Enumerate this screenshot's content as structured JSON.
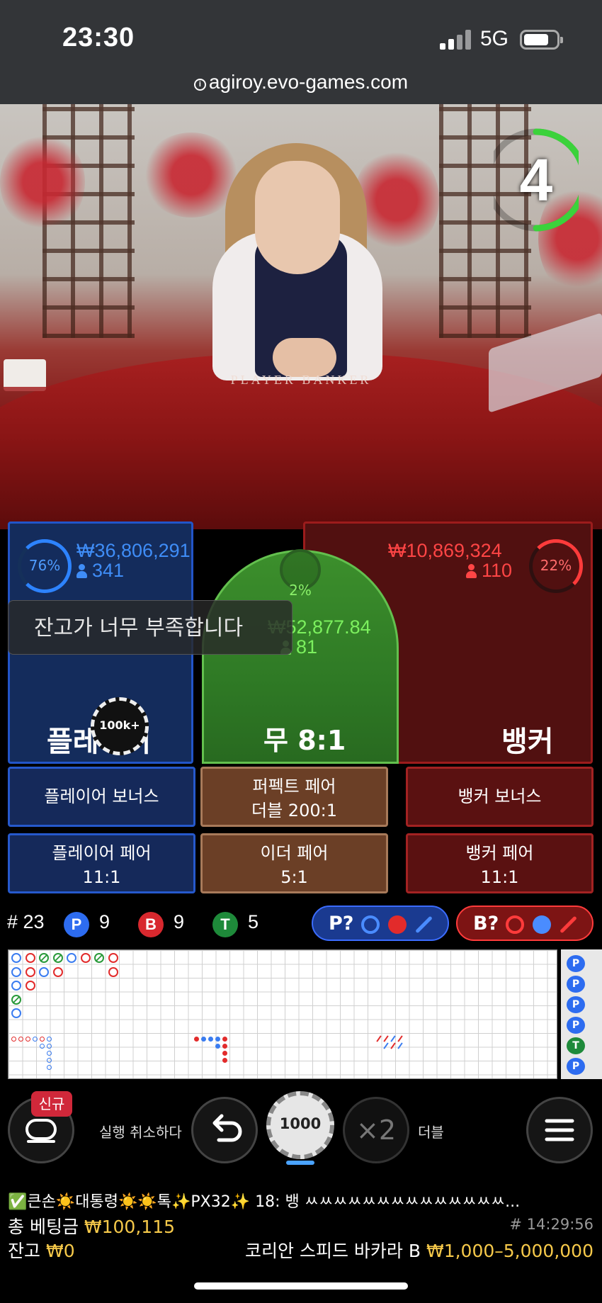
{
  "status_bar": {
    "time": "23:30",
    "network": "5G"
  },
  "browser": {
    "url": "agiroy.evo-games.com"
  },
  "video": {
    "countdown": "4",
    "felt_text": "PLAYER      BANKER"
  },
  "bets": {
    "player": {
      "label": "플레이어",
      "amount": "₩36,806,291",
      "count": "341",
      "percent": "76%"
    },
    "tie": {
      "label": "무 8:1",
      "amount": "₩52,877.84",
      "count": "81",
      "percent": "2%"
    },
    "banker": {
      "label": "뱅커",
      "amount": "₩10,869,324",
      "count": "110",
      "percent": "22%"
    },
    "toast": "잔고가 너무 부족합니다",
    "placed_chip": "100k+"
  },
  "side_bets": {
    "player_bonus": "플레이어 보너스",
    "perfect_pair": {
      "line1": "퍼펙트 페어",
      "line2": "더블 200:1"
    },
    "banker_bonus": "뱅커 보너스",
    "player_pair": {
      "line1": "플레이어 페어",
      "line2": "11:1"
    },
    "either_pair": {
      "line1": "이더 페어",
      "line2": "5:1"
    },
    "banker_pair": {
      "line1": "뱅커 페어",
      "line2": "11:1"
    }
  },
  "stats": {
    "round": "# 23",
    "player": {
      "badge": "P",
      "count": "9"
    },
    "banker": {
      "badge": "B",
      "count": "9"
    },
    "tie": {
      "badge": "T",
      "count": "5"
    },
    "predict_player": "P?",
    "predict_banker": "B?"
  },
  "roadmap_side": [
    "P",
    "P",
    "P",
    "P",
    "T",
    "P"
  ],
  "controls": {
    "new_badge": "신규",
    "undo_label": "실행 취소하다",
    "chip_value": "1000",
    "double_symbol": "×2",
    "double_label": "더블"
  },
  "footer": {
    "chat": "✅큰손☀️대통령☀️☀️톡✨PX32✨ 18: 뱅 ㅆㅆㅆㅆㅆㅆㅆㅆㅆㅆㅆㅆㅆㅆ...",
    "total_bet_label": "총 베팅금",
    "total_bet_value": "₩100,115",
    "round_id": "# 14:29:56",
    "balance_label": "잔고",
    "balance_value": "₩0",
    "table_name": "코리안 스피드 바카라 B",
    "limits": "₩1,000–5,000,000"
  },
  "colors": {
    "player_blue": "#2d83ff",
    "banker_red": "#ff3b3b",
    "tie_green": "#63c04e",
    "gold": "#f6c94a"
  },
  "icons": [
    "info-icon",
    "signal-icon",
    "battery-icon",
    "user-icon",
    "undo-icon",
    "menu-icon",
    "chat-toggle-icon"
  ]
}
